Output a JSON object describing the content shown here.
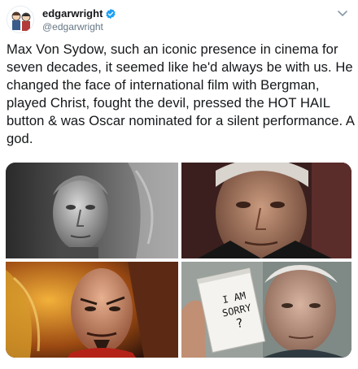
{
  "user": {
    "display_name": "edgarwright",
    "handle": "@edgarwright",
    "verified": true,
    "avatar_icon": "cartoon-avatar-icon"
  },
  "menu_icon": "chevron-down-icon",
  "tweet": {
    "text": "Max Von Sydow, such an iconic presence in cinema for seven decades, it seemed like he'd always be with us. He changed the face of international film with Bergman, played Christ, fought the devil, pressed the HOT HAIL button & was Oscar nominated for a silent performance. A god."
  },
  "media": {
    "photos": [
      {
        "name": "photo-black-and-white-portrait"
      },
      {
        "name": "photo-close-up-portrait"
      },
      {
        "name": "photo-ming-the-merciless"
      },
      {
        "name": "photo-notepad-sign"
      }
    ],
    "notepad_lines": [
      "I AM",
      "SORRY",
      "?"
    ]
  },
  "colors": {
    "text": "#14171a",
    "secondary": "#657786",
    "verified": "#1da1f2"
  }
}
